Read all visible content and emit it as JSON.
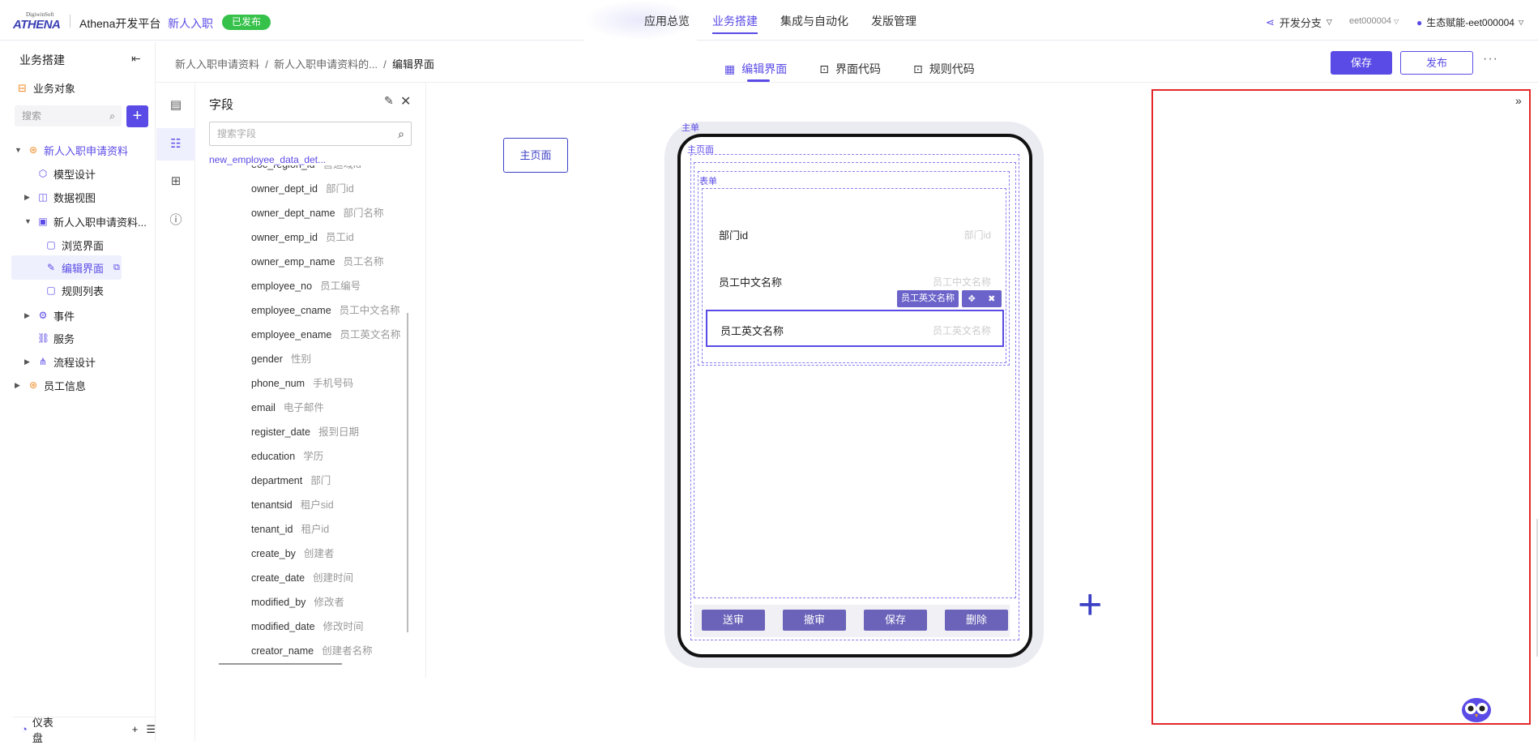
{
  "header": {
    "brand_top": "DigiwinSoft",
    "brand": "ATHENA",
    "platform": "Athena开发平台",
    "app_name": "新人入职",
    "status_badge": "已发布",
    "nav": [
      "应用总览",
      "业务搭建",
      "集成与自动化",
      "发版管理"
    ],
    "nav_active": "业务搭建",
    "branch": "开发分支",
    "tenant": "eet000004",
    "user": "生态赋能-eet000004"
  },
  "sidebar": {
    "title": "业务搭建",
    "object_label": "业务对象",
    "search_placeholder": "搜索",
    "tree": [
      {
        "label": "新人入职申请资料",
        "level": 0,
        "expand": "down",
        "icon": "object-icon"
      },
      {
        "label": "模型设计",
        "level": 1,
        "expand": "",
        "icon": "cube-icon"
      },
      {
        "label": "数据视图",
        "level": 1,
        "expand": "right",
        "icon": "chart-icon"
      },
      {
        "label": "新人入职申请资料...",
        "level": 1,
        "expand": "down",
        "icon": "form-icon"
      },
      {
        "label": "浏览界面",
        "level": 2,
        "expand": "",
        "icon": "page-icon"
      },
      {
        "label": "编辑界面",
        "level": 2,
        "expand": "",
        "icon": "edit-page-icon",
        "selected": true
      },
      {
        "label": "规则列表",
        "level": 2,
        "expand": "",
        "icon": "page-icon"
      },
      {
        "label": "事件",
        "level": 1,
        "expand": "right",
        "icon": "event-icon"
      },
      {
        "label": "服务",
        "level": 1,
        "expand": "",
        "icon": "link-icon"
      },
      {
        "label": "流程设计",
        "level": 1,
        "expand": "right",
        "icon": "flow-icon"
      },
      {
        "label": "员工信息",
        "level": 0,
        "expand": "right",
        "icon": "object-icon"
      }
    ],
    "dashboard": "仪表盘"
  },
  "breadcrumb": {
    "items": [
      "新人入职申请资料",
      "新人入职申请资料的...",
      "编辑界面"
    ]
  },
  "tabs": [
    "编辑界面",
    "界面代码",
    "规则代码"
  ],
  "actions": {
    "save": "保存",
    "publish": "发布",
    "more": "···"
  },
  "fields_panel": {
    "title": "字段",
    "search_placeholder": "搜索字段",
    "object_name": "new_employee_data_det...",
    "fields": [
      {
        "code": "eoc_region_id",
        "name": "营运域id"
      },
      {
        "code": "owner_dept_id",
        "name": "部门id"
      },
      {
        "code": "owner_dept_name",
        "name": "部门名称"
      },
      {
        "code": "owner_emp_id",
        "name": "员工id"
      },
      {
        "code": "owner_emp_name",
        "name": "员工名称"
      },
      {
        "code": "employee_no",
        "name": "员工编号"
      },
      {
        "code": "employee_cname",
        "name": "员工中文名称"
      },
      {
        "code": "employee_ename",
        "name": "员工英文名称"
      },
      {
        "code": "gender",
        "name": "性别"
      },
      {
        "code": "phone_num",
        "name": "手机号码"
      },
      {
        "code": "email",
        "name": "电子邮件"
      },
      {
        "code": "register_date",
        "name": "报到日期"
      },
      {
        "code": "education",
        "name": "学历"
      },
      {
        "code": "department",
        "name": "部门"
      },
      {
        "code": "tenantsid",
        "name": "租户sid"
      },
      {
        "code": "tenant_id",
        "name": "租户id"
      },
      {
        "code": "create_by",
        "name": "创建者"
      },
      {
        "code": "create_date",
        "name": "创建时间"
      },
      {
        "code": "modified_by",
        "name": "修改者"
      },
      {
        "code": "modified_date",
        "name": "修改时间"
      },
      {
        "code": "creator_name",
        "name": "创建者名称"
      }
    ]
  },
  "canvas": {
    "main_page_button": "主页面",
    "label_main_form": "主单",
    "label_main_page": "主页面",
    "label_form": "表单",
    "form_rows": [
      {
        "label": "部门id",
        "placeholder": "部门id"
      },
      {
        "label": "员工中文名称",
        "placeholder": "员工中文名称"
      },
      {
        "label": "员工英文名称",
        "placeholder": "员工英文名称",
        "selected": true
      }
    ],
    "selected_tag": "员工英文名称",
    "bottom_buttons": [
      "送审",
      "撤审",
      "保存",
      "删除"
    ]
  },
  "colors": {
    "accent": "#5a4be6",
    "published": "#36c24a",
    "dropzone_border": "#e4282a"
  }
}
